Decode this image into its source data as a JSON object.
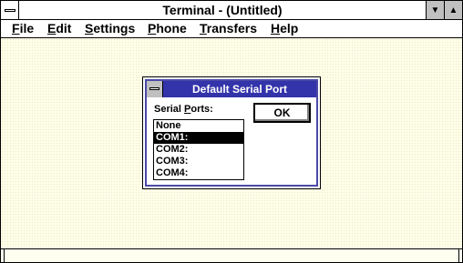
{
  "window": {
    "title": "Terminal - (Untitled)"
  },
  "menubar": {
    "items": [
      {
        "u": "F",
        "rest": "ile"
      },
      {
        "u": "E",
        "rest": "dit"
      },
      {
        "u": "S",
        "rest": "ettings"
      },
      {
        "u": "P",
        "rest": "hone"
      },
      {
        "u": "T",
        "rest": "ransfers"
      },
      {
        "u": "H",
        "rest": "elp"
      }
    ]
  },
  "dialog": {
    "title": "Default Serial Port",
    "ports_label_prefix": "Serial ",
    "ports_label_u": "P",
    "ports_label_rest": "orts:",
    "ok_label": "OK",
    "ports": [
      "None",
      "COM1:",
      "COM2:",
      "COM3:",
      "COM4:"
    ],
    "selected": "COM1:"
  },
  "icons": {
    "minimize": "down-triangle",
    "maximize": "up-triangle"
  }
}
